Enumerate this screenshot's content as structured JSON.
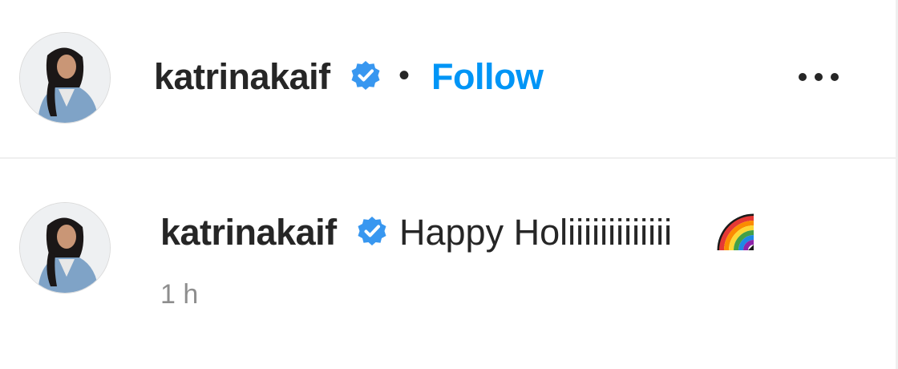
{
  "header": {
    "username": "katrinakaif",
    "separator": "•",
    "follow_label": "Follow",
    "verified_icon": "verified-badge-icon",
    "more_icon": "more-options-icon"
  },
  "comment": {
    "username": "katrinakaif",
    "text": "Happy Holiiiiiiiiiiiii",
    "emoji_icon": "rainbow-emoji-icon",
    "timestamp": "1 h"
  },
  "colors": {
    "follow_blue": "#0095f6",
    "verified_blue": "#3897f0",
    "text_primary": "#262626",
    "text_secondary": "#8e8e8e",
    "divider": "#efefef"
  }
}
